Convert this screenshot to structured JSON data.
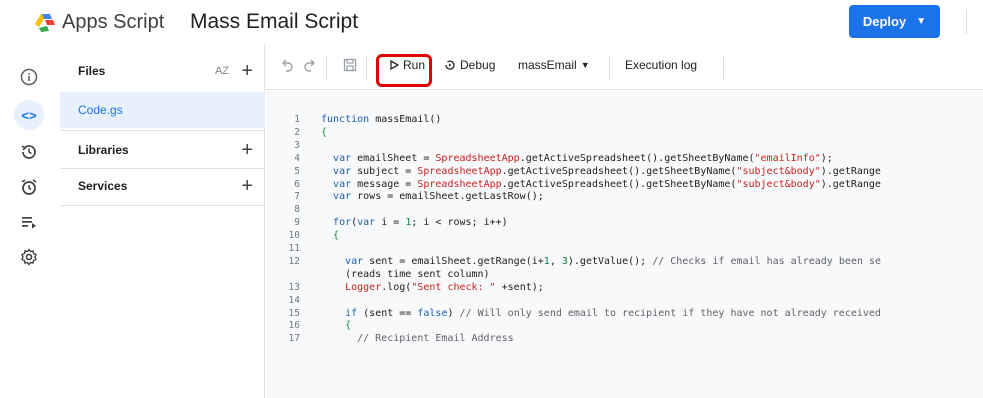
{
  "header": {
    "app_name": "Apps Script",
    "project_title": "Mass Email Script",
    "deploy_label": "Deploy"
  },
  "colors": {
    "accent": "#1a73e8",
    "highlight_border": "#e00000"
  },
  "rail": {
    "icons": [
      "info-icon",
      "code-icon",
      "history-icon",
      "alarm-icon",
      "executions-icon",
      "settings-icon"
    ]
  },
  "files_panel": {
    "files_label": "Files",
    "sort_label": "AZ",
    "file_name": "Code.gs",
    "libraries_label": "Libraries",
    "services_label": "Services"
  },
  "toolbar": {
    "run_label": "Run",
    "debug_label": "Debug",
    "function_name": "massEmail",
    "execution_log_label": "Execution log"
  },
  "code": {
    "lines": [
      {
        "n": "1",
        "text": "function massEmail()"
      },
      {
        "n": "2",
        "text": "{"
      },
      {
        "n": "3",
        "text": ""
      },
      {
        "n": "4",
        "text": "  var emailSheet = SpreadsheetApp.getActiveSpreadsheet().getSheetByName(\"emailInfo\");"
      },
      {
        "n": "5",
        "text": "  var subject = SpreadsheetApp.getActiveSpreadsheet().getSheetByName(\"subject&body\").getRange"
      },
      {
        "n": "6",
        "text": "  var message = SpreadsheetApp.getActiveSpreadsheet().getSheetByName(\"subject&body\").getRange"
      },
      {
        "n": "7",
        "text": "  var rows = emailSheet.getLastRow();"
      },
      {
        "n": "8",
        "text": ""
      },
      {
        "n": "9",
        "text": "  for(var i = 1; i < rows; i++)"
      },
      {
        "n": "10",
        "text": "  {"
      },
      {
        "n": "11",
        "text": ""
      },
      {
        "n": "12",
        "text": "    var sent = emailSheet.getRange(i+1, 3).getValue(); // Checks if email has already been se"
      },
      {
        "n": "",
        "text": "    (reads time sent column)"
      },
      {
        "n": "13",
        "text": "    Logger.log(\"Sent check: \" +sent);"
      },
      {
        "n": "14",
        "text": ""
      },
      {
        "n": "15",
        "text": "    if (sent == false) // Will only send email to recipient if they have not already received"
      },
      {
        "n": "16",
        "text": "    {"
      },
      {
        "n": "17",
        "text": "      // Recipient Email Address"
      }
    ]
  }
}
